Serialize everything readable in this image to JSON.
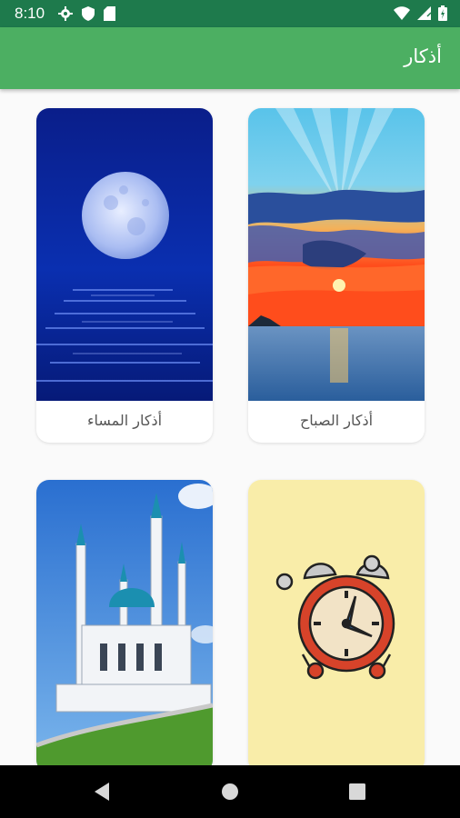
{
  "status_bar": {
    "time": "8:10",
    "left_icons": [
      "gear-icon",
      "shield-icon",
      "sd-card-icon"
    ],
    "right_icons": [
      "wifi-icon",
      "signal-icon",
      "battery-icon"
    ]
  },
  "app_bar": {
    "title": "أذكار",
    "color": "#4caf62"
  },
  "cards": [
    {
      "label": "أذكار الصباح",
      "image": "sunrise-over-sea-image"
    },
    {
      "label": "أذكار المساء",
      "image": "moon-over-sea-image"
    },
    {
      "label": "",
      "image": "alarm-clock-image"
    },
    {
      "label": "",
      "image": "mosque-image"
    }
  ],
  "nav_bar": {
    "buttons": [
      "back-icon",
      "home-icon",
      "recents-icon"
    ]
  }
}
